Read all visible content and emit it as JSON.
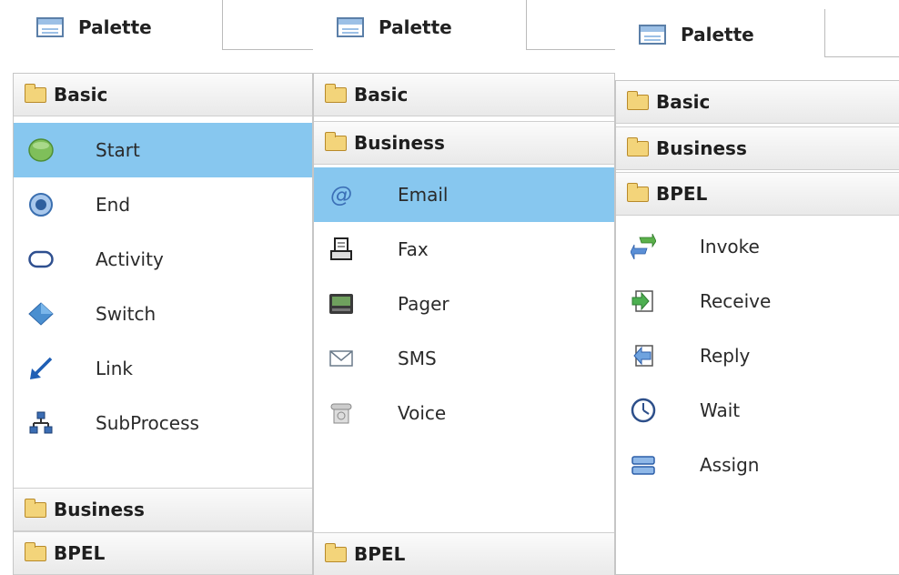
{
  "panels": [
    {
      "tab": "Palette",
      "sections": {
        "basic": "Basic",
        "business": "Business",
        "bpel": "BPEL"
      },
      "items": [
        "Start",
        "End",
        "Activity",
        "Switch",
        "Link",
        "SubProcess"
      ],
      "selected": "Start"
    },
    {
      "tab": "Palette",
      "sections": {
        "basic": "Basic",
        "business": "Business",
        "bpel": "BPEL"
      },
      "items": [
        "Email",
        "Fax",
        "Pager",
        "SMS",
        "Voice"
      ],
      "selected": "Email"
    },
    {
      "tab": "Palette",
      "sections": {
        "basic": "Basic",
        "business": "Business",
        "bpel": "BPEL"
      },
      "items": [
        "Invoke",
        "Receive",
        "Reply",
        "Wait",
        "Assign"
      ],
      "selected": null
    }
  ],
  "colors": {
    "selection": "#87c7ef",
    "header_gradient_top": "#fbfbfb",
    "header_gradient_bottom": "#e9e9e9"
  },
  "icons": {
    "basic": [
      "start-icon",
      "end-icon",
      "activity-icon",
      "switch-icon",
      "link-icon",
      "subprocess-icon"
    ],
    "business": [
      "email-icon",
      "fax-icon",
      "pager-icon",
      "sms-icon",
      "voice-icon"
    ],
    "bpel": [
      "invoke-icon",
      "receive-icon",
      "reply-icon",
      "wait-icon",
      "assign-icon"
    ]
  }
}
